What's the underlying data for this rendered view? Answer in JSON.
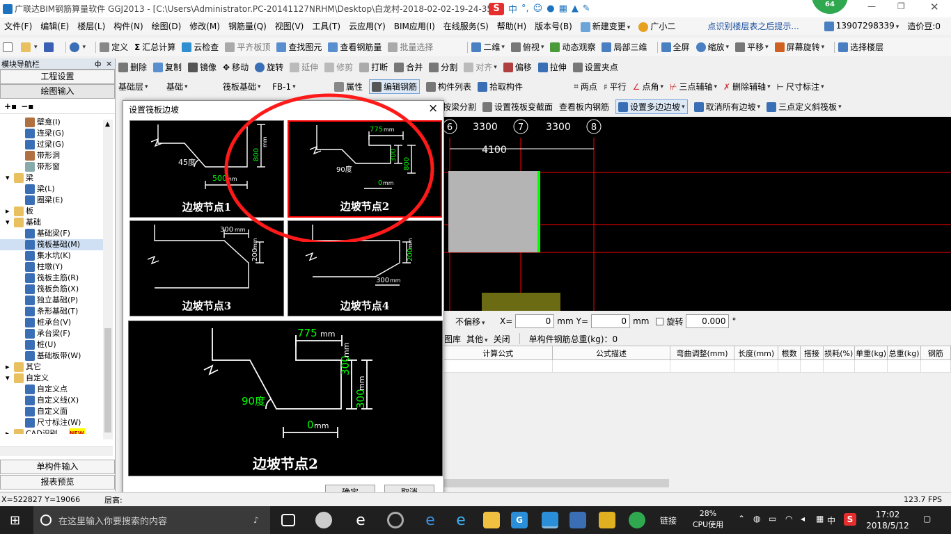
{
  "app": {
    "title": "广联达BIM钢筋算量软件 GGJ2013 - [C:\\Users\\Administrator.PC-20141127NRHM\\Desktop\\白龙村-2018-02-02-19-24-35",
    "ime": "中",
    "badge": "64"
  },
  "menu": [
    "文件(F)",
    "编辑(E)",
    "楼层(L)",
    "构件(N)",
    "绘图(D)",
    "修改(M)",
    "钢筋量(Q)",
    "视图(V)",
    "工具(T)",
    "云应用(Y)",
    "BIM应用(I)",
    "在线服务(S)",
    "帮助(H)",
    "版本号(B)"
  ],
  "menu_extra": {
    "new_change": "新建变更",
    "assistant": "广小二",
    "hint": "点识别楼层表之后提示...",
    "phone": "13907298339",
    "beans": "造价豆:0"
  },
  "toolbar1": {
    "define": "定义",
    "sum": "汇总计算",
    "cloud_check": "云检查",
    "level_top": "平齐板顶",
    "find": "查找图元",
    "view_rebar": "查看钢筋量",
    "batch": "批量选择",
    "view2d": "二维",
    "topview": "俯视",
    "dynamic": "动态观察",
    "local3d": "局部三维",
    "fullscreen": "全屏",
    "zoom": "缩放",
    "pan": "平移",
    "rotate": "屏幕旋转",
    "select_floor": "选择楼层"
  },
  "toolbar2": {
    "delete": "删除",
    "copy": "复制",
    "mirror": "镜像",
    "move": "移动",
    "rotate": "旋转",
    "extend": "延伸",
    "trim": "修剪",
    "break": "打断",
    "merge": "合并",
    "split": "分割",
    "align": "对齐",
    "offset": "偏移",
    "stretch": "拉伸",
    "set_grip": "设置夹点"
  },
  "toolbar3": {
    "layer": "基础层",
    "cat": "基础",
    "type": "筏板基础",
    "item": "FB-1",
    "attr": "属性",
    "edit_rebar": "编辑钢筋",
    "list": "构件列表",
    "pick": "拾取构件",
    "two_point": "两点",
    "parallel": "平行",
    "point_angle": "点角",
    "three_point_axis": "三点辅轴",
    "del_axis": "删除辅轴",
    "dim": "尺寸标注"
  },
  "toolbar4": {
    "beam_split": "按梁分割",
    "var_section": "设置筏板变截面",
    "view_rebar": "查看板内钢筋",
    "multi_slope": "设置多边边坡",
    "cancel_slope": "取消所有边坡",
    "three_point_slope": "三点定义斜筏板"
  },
  "nav": {
    "title": "模块导航栏",
    "pin": "ф",
    "setup": "工程设置",
    "draw": "绘图输入",
    "single": "单构件输入",
    "report": "报表预览",
    "tree": [
      {
        "t": "壁龛(I)",
        "lv": 2,
        "c": "#b07040"
      },
      {
        "t": "连梁(G)",
        "lv": 2,
        "c": "#3a6fb5"
      },
      {
        "t": "过梁(G)",
        "lv": 2,
        "c": "#3a6fb5"
      },
      {
        "t": "带形洞",
        "lv": 2,
        "c": "#b07040"
      },
      {
        "t": "带形窗",
        "lv": 2,
        "c": "#8aa"
      },
      {
        "t": "梁",
        "lv": 1,
        "c": "#e8c060",
        "open": "▾"
      },
      {
        "t": "梁(L)",
        "lv": 2,
        "c": "#3a6fb5"
      },
      {
        "t": "圈梁(E)",
        "lv": 2,
        "c": "#3a6fb5"
      },
      {
        "t": "板",
        "lv": 1,
        "c": "#e8c060",
        "open": "▸"
      },
      {
        "t": "基础",
        "lv": 1,
        "c": "#e8c060",
        "open": "▾"
      },
      {
        "t": "基础梁(F)",
        "lv": 2,
        "c": "#3a6fb5"
      },
      {
        "t": "筏板基础(M)",
        "lv": 2,
        "c": "#3a6fb5",
        "sel": true
      },
      {
        "t": "集水坑(K)",
        "lv": 2,
        "c": "#3a6fb5"
      },
      {
        "t": "柱墩(Y)",
        "lv": 2,
        "c": "#3a6fb5"
      },
      {
        "t": "筏板主筋(R)",
        "lv": 2,
        "c": "#3a6fb5"
      },
      {
        "t": "筏板负筋(X)",
        "lv": 2,
        "c": "#3a6fb5"
      },
      {
        "t": "独立基础(P)",
        "lv": 2,
        "c": "#3a6fb5"
      },
      {
        "t": "条形基础(T)",
        "lv": 2,
        "c": "#3a6fb5"
      },
      {
        "t": "桩承台(V)",
        "lv": 2,
        "c": "#3a6fb5"
      },
      {
        "t": "承台梁(F)",
        "lv": 2,
        "c": "#3a6fb5"
      },
      {
        "t": "桩(U)",
        "lv": 2,
        "c": "#3a6fb5"
      },
      {
        "t": "基础板带(W)",
        "lv": 2,
        "c": "#3a6fb5"
      },
      {
        "t": "其它",
        "lv": 1,
        "c": "#e8c060",
        "open": "▸"
      },
      {
        "t": "自定义",
        "lv": 1,
        "c": "#e8c060",
        "open": "▾"
      },
      {
        "t": "自定义点",
        "lv": 2,
        "c": "#3a6fb5"
      },
      {
        "t": "自定义线(X)",
        "lv": 2,
        "c": "#3a6fb5"
      },
      {
        "t": "自定义面",
        "lv": 2,
        "c": "#3a6fb5"
      },
      {
        "t": "尺寸标注(W)",
        "lv": 2,
        "c": "#3a6fb5"
      },
      {
        "t": "CAD识别",
        "lv": 1,
        "c": "#e8c060",
        "open": "▸",
        "badge": "NEW"
      }
    ]
  },
  "canvas": {
    "axis": [
      "6",
      "7",
      "8"
    ],
    "dims": [
      "3300",
      "3300"
    ],
    "total": "4100"
  },
  "panel": {
    "offset": "不偏移",
    "x_label": "X=",
    "x_val": "0",
    "y_label": "Y=",
    "y_val": "0",
    "unit": "mm",
    "rotate": "旋转",
    "rot_val": "0.000",
    "deg": "°",
    "lib": "图库",
    "other": "其他",
    "close": "关闭",
    "total": "单构件钢筋总重(kg)：0",
    "cols": [
      "计算公式",
      "公式描述",
      "弯曲调整(mm)",
      "长度(mm)",
      "根数",
      "搭接",
      "损耗(%)",
      "单重(kg)",
      "总重(kg)",
      "钢筋"
    ]
  },
  "dialog": {
    "title": "设置筏板边坡",
    "close": "×",
    "ok": "确定",
    "cancel": "取消",
    "tiles": [
      {
        "label": "边坡节点1",
        "angle": "45度",
        "w": "500",
        "h": "800",
        "unit": "mm"
      },
      {
        "label": "边坡节点2",
        "top": "775",
        "h1": "300",
        "h2": "800",
        "angle": "90度",
        "w": "0",
        "unit": "mm"
      },
      {
        "label": "边坡节点3",
        "top": "300",
        "h": "200",
        "unit": "mm"
      },
      {
        "label": "边坡节点4",
        "h": "200",
        "w": "300",
        "unit": "mm"
      }
    ],
    "preview": {
      "label": "边坡节点2",
      "top": "775",
      "h1": "300",
      "h2": "300",
      "angle": "90度",
      "w": "0",
      "unit": "mm"
    }
  },
  "status": {
    "coords": "X=522827 Y=19066",
    "floor": "层高:",
    "fps": "123.7 FPS"
  },
  "taskbar": {
    "search": "在这里输入你要搜索的内容",
    "link": "链接",
    "cpu": "28%",
    "cpu_label": "CPU使用",
    "lang": "中",
    "time": "17:02",
    "date": "2018/5/12"
  },
  "colors": {
    "annotation": "#ff1a1a",
    "dim_green": "#00ff00",
    "axis_red": "#ff0000",
    "slab": "#b4b4b4",
    "olive": "#6b6b14"
  }
}
